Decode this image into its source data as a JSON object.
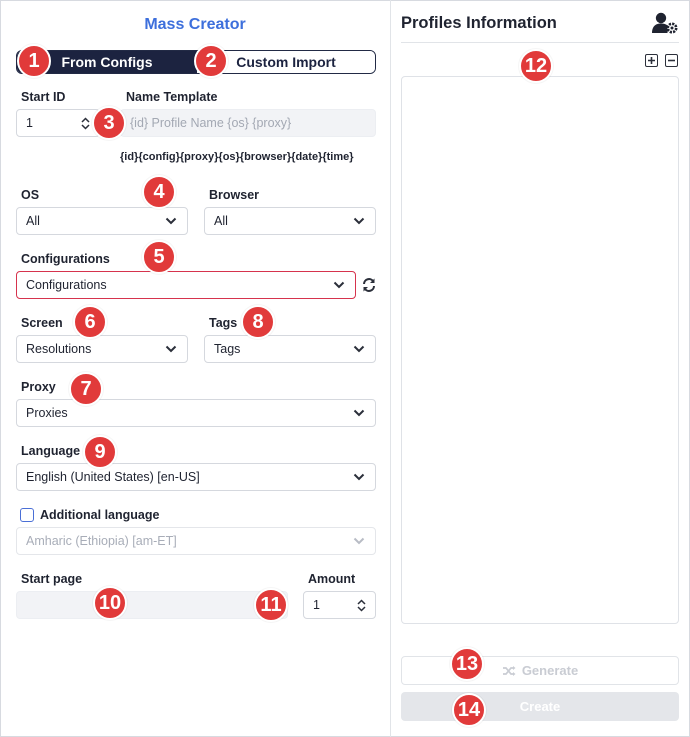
{
  "left": {
    "title": "Mass Creator",
    "mode_tabs": [
      "From Configs",
      "Custom Import"
    ],
    "start_id": {
      "label": "Start ID",
      "value": "1"
    },
    "name_template": {
      "label": "Name Template",
      "placeholder": "{id} Profile Name {os} {proxy}"
    },
    "template_tokens": "{id}{config}{proxy}{os}{browser}{date}{time}",
    "os": {
      "label": "OS",
      "value": "All"
    },
    "browser": {
      "label": "Browser",
      "value": "All"
    },
    "configurations": {
      "label": "Configurations",
      "value": "Configurations"
    },
    "screen": {
      "label": "Screen",
      "value": "Resolutions"
    },
    "tags": {
      "label": "Tags",
      "value": "Tags"
    },
    "proxy": {
      "label": "Proxy",
      "value": "Proxies"
    },
    "language": {
      "label": "Language",
      "value": "English (United States) [en-US]"
    },
    "additional_language": {
      "label": "Additional language",
      "value": "Amharic (Ethiopia) [am-ET]",
      "checked": false
    },
    "start_page": {
      "label": "Start page",
      "value": ""
    },
    "amount": {
      "label": "Amount",
      "value": "1"
    }
  },
  "right": {
    "title": "Profiles Information",
    "generate_label": "Generate",
    "create_label": "Create"
  },
  "badges": [
    "1",
    "2",
    "3",
    "4",
    "5",
    "6",
    "7",
    "8",
    "9",
    "10",
    "11",
    "12",
    "13",
    "14"
  ],
  "colors": {
    "accent": "#3d6fdc",
    "dark": "#1c2340",
    "badge": "#e13a3a",
    "error_border": "#d6334d"
  },
  "icons": [
    "chevron-down-icon",
    "refresh-icon",
    "user-settings-icon",
    "expand-all-icon",
    "collapse-all-icon",
    "shuffle-icon",
    "stepper-up-icon",
    "stepper-down-icon"
  ]
}
